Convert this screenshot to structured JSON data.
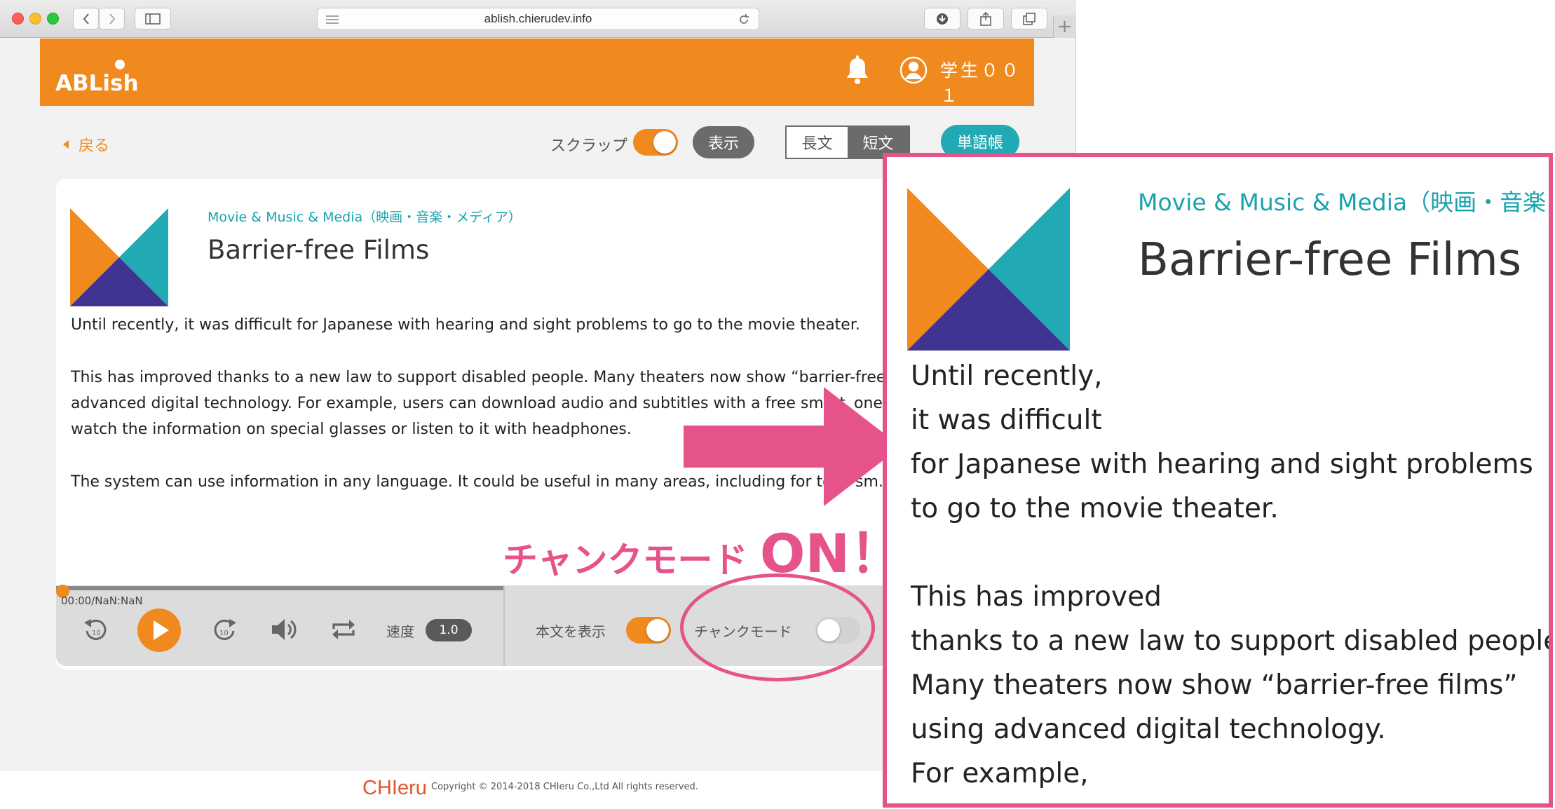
{
  "browser": {
    "url": "ablish.chierudev.info",
    "new_tab": "+"
  },
  "header": {
    "logo": "ABLish",
    "user_name": "学生００１",
    "brand_color": "#f08a1e"
  },
  "toolbar": {
    "back_label": "戻る",
    "scrap_label": "スクラップ",
    "scrap_on": true,
    "show_label": "表示",
    "long_text_label": "長文",
    "short_text_label": "短文",
    "selected_length": "短文",
    "vocab_label": "単語帳"
  },
  "article": {
    "category": "Movie & Music & Media（映画・音楽・メディア）",
    "title": "Barrier-free Films",
    "paragraphs": [
      "Until recently, it was difficult for Japanese with hearing and sight problems to go to the movie theater.",
      "This has improved thanks to a new law to support disabled people. Many theaters now show “barrier-free fi",
      "advanced digital technology. For example, users can download audio and subtitles with a free smart",
      "watch the information on special glasses or listen to it with headphones.",
      "The system can use information in any language. It could be useful in many areas, including for tou"
    ],
    "paragraph_tail": {
      "p1_tail": "one a",
      "p3_tail": "sm."
    }
  },
  "player": {
    "time": "00:00/NaN:NaN",
    "progress": 0,
    "speed_label": "速度",
    "speed_value": "1.0",
    "show_text_label": "本文を表示",
    "show_text_on": true,
    "chunk_mode_label": "チャンクモード",
    "chunk_mode_on": false
  },
  "footer": {
    "logo": "CHIeru",
    "copyright": "Copyright © 2014-2018 CHIeru Co.,Ltd All rights reserved."
  },
  "annotation": {
    "chunk_on_text": "チャンクモード",
    "chunk_on_big": "ON！",
    "accent_color": "#e6538a"
  },
  "zoom": {
    "category": "Movie & Music & Media（映画・音楽",
    "title": "Barrier-free Films",
    "lines": [
      "Until recently,",
      "it was difficult",
      "for Japanese with hearing and sight problems",
      "to go to the movie theater.",
      "",
      "This has improved",
      "thanks to a new law to support disabled people.",
      "Many theaters now show “barrier-free films”",
      "using advanced digital technology.",
      "For example,"
    ]
  }
}
